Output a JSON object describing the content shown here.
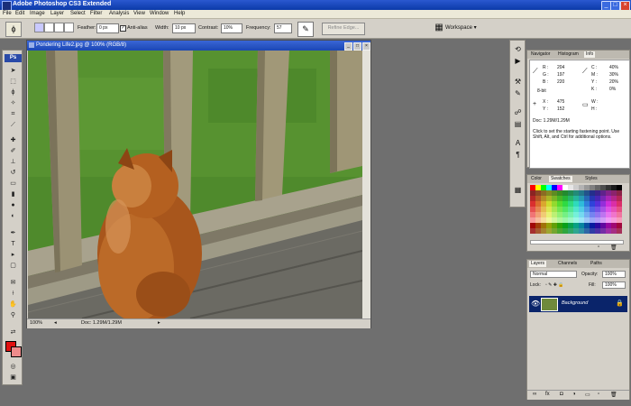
{
  "window": {
    "title": "Adobe Photoshop CS3 Extended"
  },
  "menu": [
    "File",
    "Edit",
    "Image",
    "Layer",
    "Select",
    "Filter",
    "Analysis",
    "View",
    "Window",
    "Help"
  ],
  "options": {
    "feather_label": "Feather:",
    "feather_value": "0 px",
    "antialias_label": "Anti-alias",
    "width_label": "Width:",
    "width_value": "10 px",
    "contrast_label": "Contrast:",
    "contrast_value": "10%",
    "frequency_label": "Frequency:",
    "frequency_value": "57",
    "refine_edge": "Refine Edge...",
    "workspace": "Workspace ▾"
  },
  "document": {
    "title": "Pondering Life2.jpg @ 100% (RGB/8)",
    "zoom": "100%",
    "doc_size": "Doc: 1.29M/1.29M"
  },
  "info_panel": {
    "tabs": [
      "Navigator",
      "Histogram",
      "Info"
    ],
    "rows": [
      [
        "R :",
        "204",
        "C :",
        "40%"
      ],
      [
        "G :",
        "197",
        "M :",
        "30%"
      ],
      [
        "B :",
        "220",
        "Y :",
        "20%"
      ],
      [
        "8-bit",
        "",
        "K :",
        "0%"
      ],
      [
        "X :",
        "475",
        "W :",
        ""
      ],
      [
        "Y :",
        "152",
        "H :",
        ""
      ]
    ],
    "doc": "Doc: 1.29M/1.29M",
    "hint": "Click to set the starting fastening point. Use Shift, Alt, and Ctrl for additional options."
  },
  "swatches": {
    "tabs": [
      "Color",
      "Swatches",
      "Styles"
    ]
  },
  "layers": {
    "tabs": [
      "Layers",
      "Channels",
      "Paths"
    ],
    "blend_mode": "Normal",
    "opacity_label": "Opacity:",
    "opacity": "100%",
    "lock_label": "Lock:",
    "fill_label": "Fill:",
    "fill": "100%",
    "items": [
      {
        "name": "Background"
      }
    ]
  }
}
